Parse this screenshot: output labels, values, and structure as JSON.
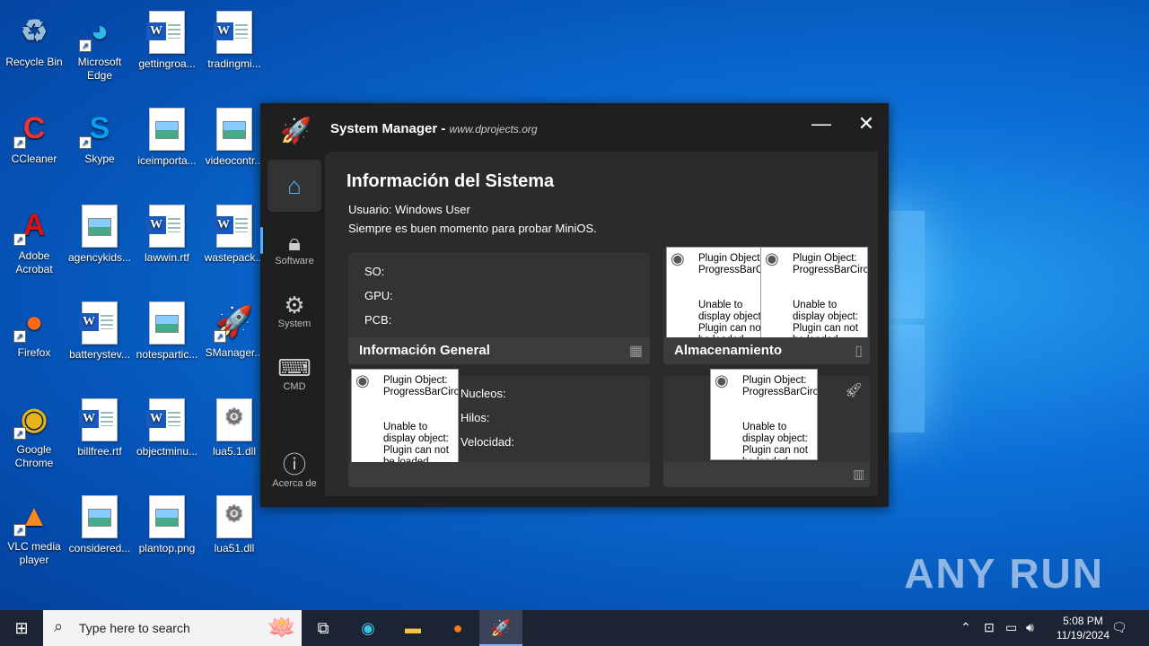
{
  "desktop": {
    "icons": [
      {
        "label": "Recycle Bin",
        "icon": "recycle-bin-icon"
      },
      {
        "label": "Microsoft Edge",
        "icon": "edge-icon"
      },
      {
        "label": "gettingroa...",
        "icon": "word-doc-icon"
      },
      {
        "label": "tradingmi...",
        "icon": "word-doc-icon"
      },
      {
        "label": "CCleaner",
        "icon": "ccleaner-icon"
      },
      {
        "label": "Skype",
        "icon": "skype-icon"
      },
      {
        "label": "iceimporta...",
        "icon": "image-file-icon"
      },
      {
        "label": "videocontr...",
        "icon": "image-file-icon"
      },
      {
        "label": "Adobe Acrobat",
        "icon": "acrobat-icon"
      },
      {
        "label": "agencykids...",
        "icon": "image-file-icon"
      },
      {
        "label": "lawwin.rtf",
        "icon": "word-doc-icon"
      },
      {
        "label": "wastepack...",
        "icon": "word-doc-icon"
      },
      {
        "label": "Firefox",
        "icon": "firefox-icon"
      },
      {
        "label": "batterystev...",
        "icon": "word-doc-icon"
      },
      {
        "label": "notespartic...",
        "icon": "image-file-icon"
      },
      {
        "label": "SManager...",
        "icon": "smanager-icon"
      },
      {
        "label": "Google Chrome",
        "icon": "chrome-icon"
      },
      {
        "label": "billfree.rtf",
        "icon": "word-doc-icon"
      },
      {
        "label": "objectminu...",
        "icon": "word-doc-icon"
      },
      {
        "label": "lua5.1.dll",
        "icon": "dll-file-icon"
      },
      {
        "label": "VLC media player",
        "icon": "vlc-icon"
      },
      {
        "label": "considered...",
        "icon": "image-file-icon"
      },
      {
        "label": "plantop.png",
        "icon": "image-file-icon"
      },
      {
        "label": "lua51.dll",
        "icon": "dll-file-icon"
      }
    ],
    "watermark": "ANY RUN"
  },
  "window": {
    "title": "System Manager - ",
    "site": "www.dprojects.org",
    "nav": {
      "home": "",
      "software": "Software",
      "system": "System",
      "cmd": "CMD",
      "about": "Acerca de"
    },
    "heading": "Información del Sistema",
    "user_line": "Usuario: Windows User",
    "tagline": "Siempre es buen momento para probar MiniOS.",
    "general": {
      "so": "SO:",
      "gpu": "GPU:",
      "pcb": "PCB:",
      "header": "Información General"
    },
    "storage": {
      "header": "Almacenamiento"
    },
    "cpu": {
      "nucleos": "Nucleos:",
      "hilos": "Hilos:",
      "velocidad": "Velocidad:"
    },
    "plugin": {
      "line1": "Plugin Object:\nProgressBarCircle",
      "line2": "Unable to\ndisplay object:\nPlugin can not\nbe loaded"
    }
  },
  "taskbar": {
    "search_placeholder": "Type here to search",
    "time": "5:08 PM",
    "date": "11/19/2024"
  }
}
